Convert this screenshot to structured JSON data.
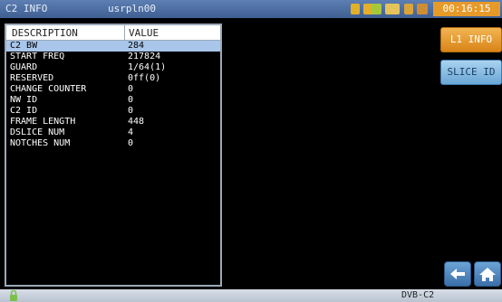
{
  "header": {
    "title": "C2 INFO",
    "user": "usrpln00",
    "time": "00:16:15",
    "status_icons": [
      "battery-icon",
      "signal-icon",
      "storage-icon",
      "wifi-icon",
      "power-icon"
    ]
  },
  "table": {
    "columns": [
      "DESCRIPTION",
      "VALUE"
    ],
    "rows": [
      {
        "desc": "C2 BW",
        "value": "284",
        "selected": true
      },
      {
        "desc": "START FREQ",
        "value": "217824"
      },
      {
        "desc": "GUARD",
        "value": "1/64(1)"
      },
      {
        "desc": "RESERVED",
        "value": "0ff(0)"
      },
      {
        "desc": "CHANGE COUNTER",
        "value": "0"
      },
      {
        "desc": "NW ID",
        "value": "0"
      },
      {
        "desc": "C2 ID",
        "value": "0"
      },
      {
        "desc": "FRAME LENGTH",
        "value": "448"
      },
      {
        "desc": "DSLICE NUM",
        "value": "4"
      },
      {
        "desc": "NOTCHES NUM",
        "value": "0"
      }
    ]
  },
  "buttons": {
    "l1_info": "L1 INFO",
    "slice_id": "SLICE ID",
    "back": "back-arrow-icon",
    "home": "home-icon"
  },
  "footer": {
    "mode": "DVB-C2",
    "left_icon": "lock-icon"
  },
  "colors": {
    "accent_orange": "#e69a2a",
    "top_bar_blue": "#4a6ea6",
    "selected_row": "#a9c6ea"
  }
}
